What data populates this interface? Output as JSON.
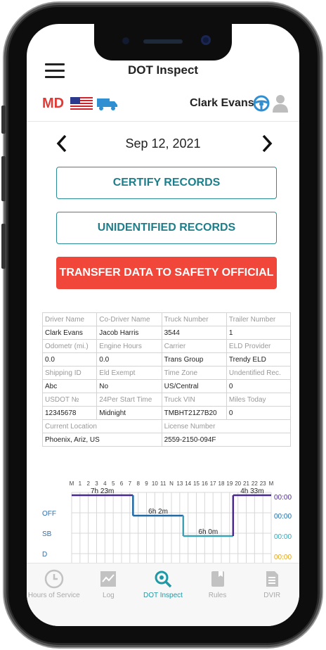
{
  "header": {
    "title": "DOT Inspect"
  },
  "status": {
    "state_code": "MD",
    "driver_name": "Clark Evans"
  },
  "date_nav": {
    "date": "Sep 12, 2021"
  },
  "actions": {
    "certify": "CERTIFY RECORDS",
    "unidentified": "UNIDENTIFIED RECORDS",
    "transfer": "TRANSFER DATA TO SAFETY OFFICIAL"
  },
  "info_table": {
    "rows": [
      [
        {
          "t": "h",
          "v": "Driver Name"
        },
        {
          "t": "h",
          "v": "Co-Driver Name"
        },
        {
          "t": "h",
          "v": "Truck Number"
        },
        {
          "t": "h",
          "v": "Trailer Number"
        }
      ],
      [
        {
          "t": "v",
          "v": "Clark Evans"
        },
        {
          "t": "v",
          "v": "Jacob Harris"
        },
        {
          "t": "v",
          "v": "3544"
        },
        {
          "t": "v",
          "v": "1"
        }
      ],
      [
        {
          "t": "h",
          "v": "Odometr (mi.)"
        },
        {
          "t": "h",
          "v": "Engine Hours"
        },
        {
          "t": "h",
          "v": "Carrier"
        },
        {
          "t": "h",
          "v": "ELD Provider"
        }
      ],
      [
        {
          "t": "v",
          "v": "0.0"
        },
        {
          "t": "v",
          "v": "0.0"
        },
        {
          "t": "v",
          "v": "Trans Group"
        },
        {
          "t": "v",
          "v": "Trendy ELD"
        }
      ],
      [
        {
          "t": "h",
          "v": "Shipping ID"
        },
        {
          "t": "h",
          "v": "Eld Exempt"
        },
        {
          "t": "h",
          "v": "Time Zone"
        },
        {
          "t": "h",
          "v": "Undentified Rec."
        }
      ],
      [
        {
          "t": "v",
          "v": "Abc"
        },
        {
          "t": "v",
          "v": "No"
        },
        {
          "t": "v",
          "v": "US/Central"
        },
        {
          "t": "v",
          "v": "0"
        }
      ],
      [
        {
          "t": "h",
          "v": "USDOT №"
        },
        {
          "t": "h",
          "v": "24Per Start Time"
        },
        {
          "t": "h",
          "v": "Truck VIN"
        },
        {
          "t": "h",
          "v": "Miles Today"
        }
      ],
      [
        {
          "t": "v",
          "v": "12345678"
        },
        {
          "t": "v",
          "v": "Midnight"
        },
        {
          "t": "v",
          "v": "TMBHT21Z7B20"
        },
        {
          "t": "v",
          "v": "0"
        }
      ],
      [
        {
          "t": "h",
          "v": "Current Location",
          "span": 2
        },
        {
          "t": "h",
          "v": "License Number",
          "span": 2
        }
      ],
      [
        {
          "t": "v",
          "v": "Phoenix, Ariz, US",
          "span": 2
        },
        {
          "t": "v",
          "v": "2559-2150-094F",
          "span": 2
        }
      ]
    ]
  },
  "log_chart": {
    "hour_labels": [
      "M",
      "1",
      "2",
      "3",
      "4",
      "5",
      "6",
      "7",
      "8",
      "9",
      "10",
      "11",
      "N",
      "13",
      "14",
      "15",
      "16",
      "17",
      "18",
      "19",
      "20",
      "21",
      "22",
      "23",
      "M"
    ],
    "row_labels": [
      "OFF",
      "SB",
      "D"
    ],
    "segments": [
      {
        "label": "7h 23m",
        "start": 0,
        "end": 7.38,
        "row": 0,
        "color": "#4b2a8f"
      },
      {
        "label": "6h 2m",
        "start": 7.38,
        "end": 13.42,
        "row": 1,
        "color": "#1f6aa5"
      },
      {
        "label": "6h 0m",
        "start": 13.42,
        "end": 19.42,
        "row": 2,
        "color": "#3aa3b5"
      },
      {
        "label": "4h 33m",
        "start": 19.42,
        "end": 24,
        "row": 0,
        "color": "#4b2a8f"
      }
    ],
    "totals": [
      {
        "value": "00:00",
        "color": "#4b2a8f"
      },
      {
        "value": "00:00",
        "color": "#1f6aa5"
      },
      {
        "value": "00:00",
        "color": "#3aa3b5"
      },
      {
        "value": "00:00",
        "color": "#e0a422"
      }
    ]
  },
  "tabs": [
    {
      "label": "Hours of Service",
      "icon": "clock-icon",
      "active": false
    },
    {
      "label": "Log",
      "icon": "log-chart-icon",
      "active": false
    },
    {
      "label": "DOT Inspect",
      "icon": "inspect-search-icon",
      "active": true
    },
    {
      "label": "Rules",
      "icon": "rules-book-icon",
      "active": false
    },
    {
      "label": "DVIR",
      "icon": "dvir-document-icon",
      "active": false
    }
  ],
  "colors": {
    "accent": "#1e9aa6",
    "danger": "#f0473a",
    "state": "#e53935"
  }
}
